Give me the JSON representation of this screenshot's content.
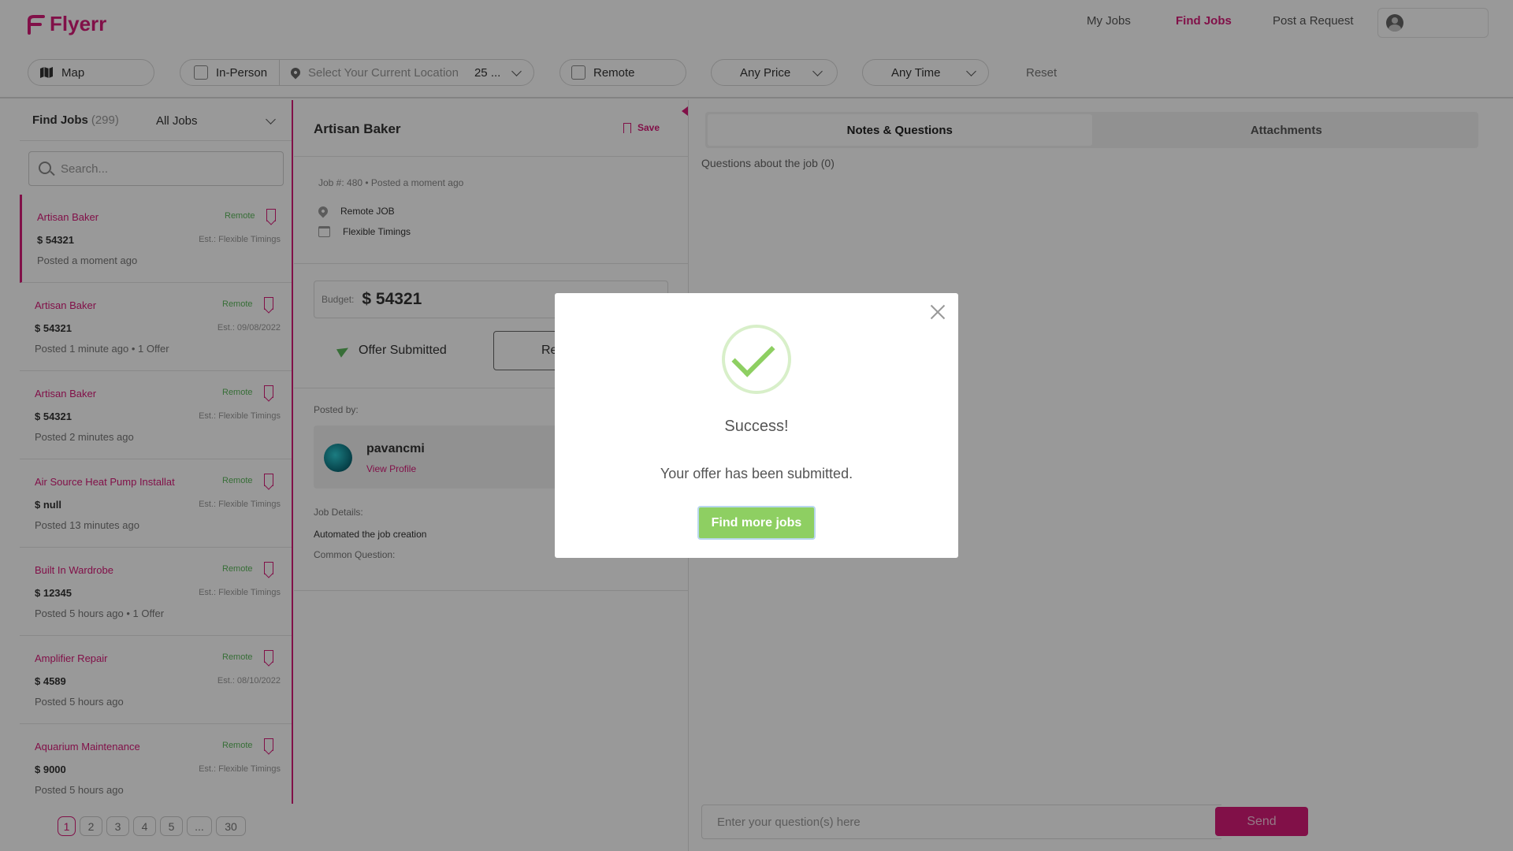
{
  "header": {
    "logo_text": "Flyerr",
    "nav": {
      "my_jobs": "My Jobs",
      "find_jobs": "Find Jobs",
      "post_request": "Post a Request"
    },
    "brand_color": "#d81b79"
  },
  "filters": {
    "map": "Map",
    "in_person": "In-Person",
    "location_placeholder": "Select Your Current Location",
    "distance": "25 ...",
    "remote": "Remote",
    "price": "Any Price",
    "time": "Any Time",
    "reset": "Reset"
  },
  "job_list": {
    "title": "Find Jobs",
    "count": "(299)",
    "filter": "All Jobs",
    "search_placeholder": "Search...",
    "items": [
      {
        "title": "Artisan Baker",
        "tag": "Remote",
        "price": "$ 54321",
        "est": "Est.: Flexible Timings",
        "posted": "Posted a moment ago"
      },
      {
        "title": "Artisan Baker",
        "tag": "Remote",
        "price": "$ 54321",
        "est": "Est.: 09/08/2022",
        "posted": "Posted 1 minute ago  • 1 Offer"
      },
      {
        "title": "Artisan Baker",
        "tag": "Remote",
        "price": "$ 54321",
        "est": "Est.: Flexible Timings",
        "posted": "Posted 2 minutes ago"
      },
      {
        "title": "Air Source Heat Pump Installat",
        "tag": "Remote",
        "price": "$ null",
        "est": "Est.: Flexible Timings",
        "posted": "Posted 13 minutes ago"
      },
      {
        "title": "Built In Wardrobe",
        "tag": "Remote",
        "price": "$ 12345",
        "est": "Est.: Flexible Timings",
        "posted": "Posted 5 hours ago  • 1 Offer"
      },
      {
        "title": "Amplifier Repair",
        "tag": "Remote",
        "price": "$ 4589",
        "est": "Est.: 08/10/2022",
        "posted": "Posted 5 hours ago"
      },
      {
        "title": "Aquarium Maintenance",
        "tag": "Remote",
        "price": "$ 9000",
        "est": "Est.: Flexible Timings",
        "posted": "Posted 5 hours ago"
      }
    ],
    "pages": [
      "1",
      "2",
      "3",
      "4",
      "5",
      "...",
      "30"
    ]
  },
  "detail": {
    "title": "Artisan Baker",
    "save": "Save",
    "meta": "Job #: 480 • Posted a moment ago",
    "location": "Remote JOB",
    "timing": "Flexible Timings",
    "budget_label": "Budget:",
    "budget_value": "$ 54321",
    "offer_submitted": "Offer Submitted",
    "second_button": "Re",
    "posted_by": "Posted by:",
    "poster_name": "pavancmi",
    "view_profile": "View Profile",
    "job_details_label": "Job Details:",
    "job_details_text": "Automated the job creation",
    "common_question": "Common Question:"
  },
  "questions": {
    "tab_notes": "Notes & Questions",
    "tab_attachments": "Attachments",
    "count_text": "Questions about the job (0)",
    "input_placeholder": "Enter your question(s) here",
    "send": "Send"
  },
  "modal": {
    "title": "Success!",
    "message": "Your offer has been submitted.",
    "button": "Find more jobs",
    "accent": "#8ecf62"
  }
}
